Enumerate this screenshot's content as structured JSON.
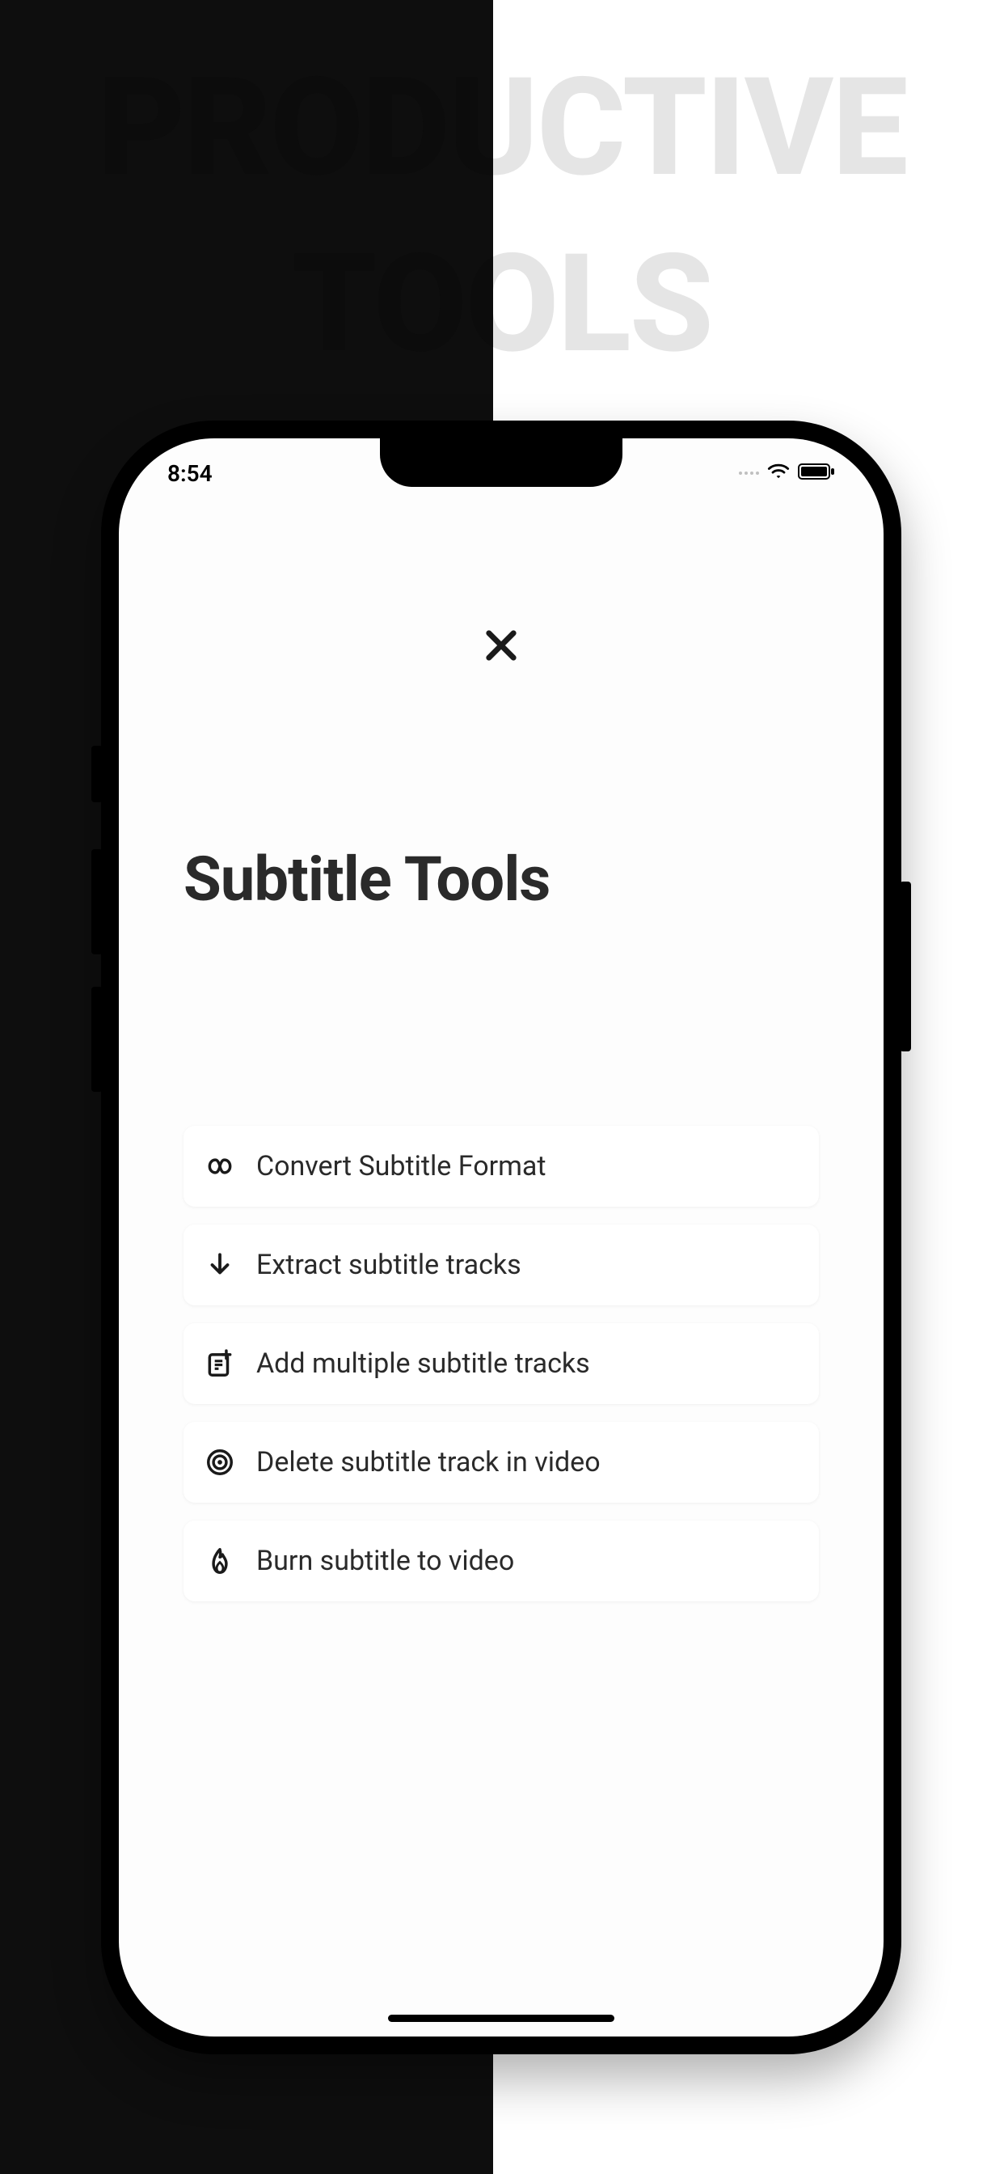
{
  "hero": {
    "line1": "PRODUCTIVE",
    "line2": "TOOLS"
  },
  "status": {
    "time": "8:54"
  },
  "page": {
    "title": "Subtitle Tools"
  },
  "tools": [
    {
      "icon": "infinity",
      "label": "Convert Subtitle Format"
    },
    {
      "icon": "download",
      "label": "Extract subtitle tracks"
    },
    {
      "icon": "add-doc",
      "label": "Add multiple subtitle tracks"
    },
    {
      "icon": "target",
      "label": "Delete subtitle track in video"
    },
    {
      "icon": "fire",
      "label": "Burn subtitle to video"
    }
  ]
}
